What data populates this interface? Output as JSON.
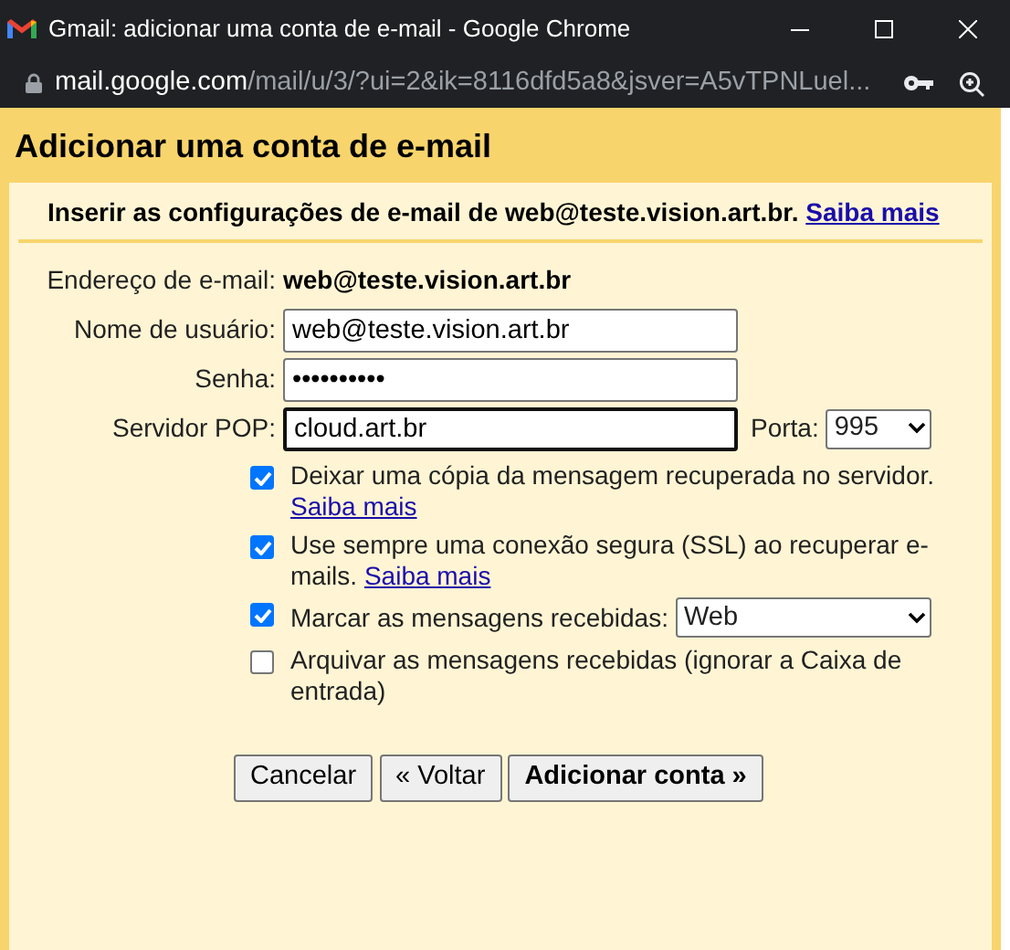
{
  "window": {
    "title": "Gmail: adicionar uma conta de e-mail - Google Chrome"
  },
  "address_bar": {
    "domain": "mail.google.com",
    "path": "/mail/u/3/?ui=2&ik=8116dfd5a8&jsver=A5vTPNLuel..."
  },
  "dialog": {
    "title": "Adicionar uma conta de e-mail",
    "instruction": "Inserir as configurações de e-mail de web@teste.vision.art.br.",
    "instruction_link": "Saiba mais",
    "fields": [
      {
        "kind": "static",
        "label": "Endereço de e-mail:",
        "value": "web@teste.vision.art.br"
      },
      {
        "kind": "text",
        "label": "Nome de usuário:",
        "value": "web@teste.vision.art.br",
        "focused": false
      },
      {
        "kind": "text",
        "label": "Senha:",
        "value": "••••••••••",
        "focused": false
      },
      {
        "kind": "text",
        "label": "Servidor POP:",
        "value": "cloud.art.br",
        "focused": true,
        "port_label": "Porta:",
        "port": "995"
      }
    ],
    "options": [
      {
        "label": "Deixar uma cópia da mensagem recuperada no servidor.",
        "link": "Saiba mais",
        "checked": true
      },
      {
        "label": "Use sempre uma conexão segura (SSL) ao recuperar e-mails.",
        "link": "Saiba mais",
        "checked": true
      },
      {
        "label": "Marcar as mensagens recebidas:",
        "select": "Web",
        "checked": true
      },
      {
        "label": "Arquivar as mensagens recebidas (ignorar a Caixa de entrada)",
        "checked": false
      }
    ],
    "buttons": [
      {
        "label": "Cancelar",
        "primary": false
      },
      {
        "label": "« Voltar",
        "primary": false
      },
      {
        "label": "Adicionar conta »",
        "primary": true
      }
    ]
  }
}
